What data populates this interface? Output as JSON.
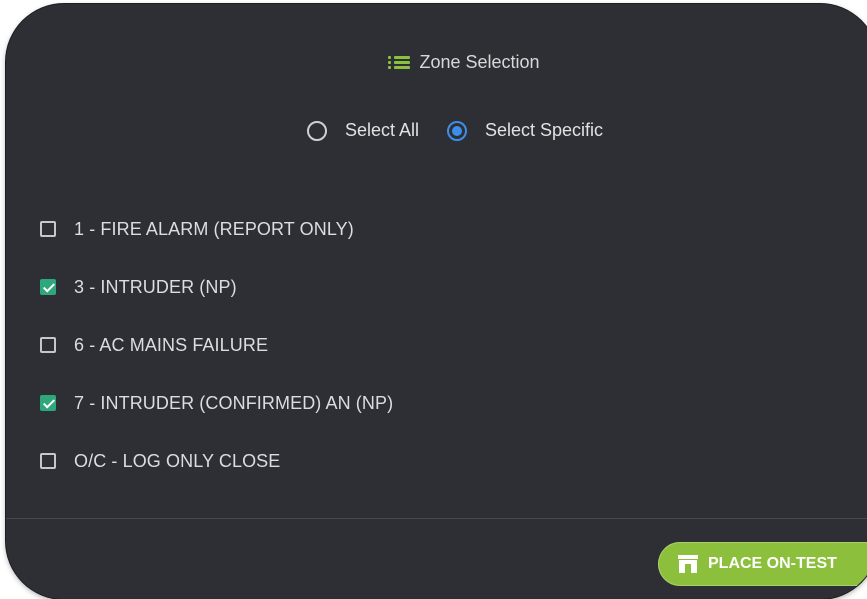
{
  "header": {
    "icon": "list-icon",
    "title": "Zone Selection"
  },
  "selection_mode": {
    "options": [
      {
        "label": "Select All",
        "selected": false
      },
      {
        "label": "Select Specific",
        "selected": true
      }
    ]
  },
  "zones": [
    {
      "label": "1 - FIRE ALARM (REPORT ONLY)",
      "checked": false
    },
    {
      "label": "3 - INTRUDER (NP)",
      "checked": true
    },
    {
      "label": "6 - AC MAINS FAILURE",
      "checked": false
    },
    {
      "label": "7 - INTRUDER (CONFIRMED) AN (NP)",
      "checked": true
    },
    {
      "label": "O/C - LOG ONLY CLOSE",
      "checked": false
    }
  ],
  "footer": {
    "action_label": "PLACE ON-TEST",
    "action_icon": "store-icon"
  },
  "colors": {
    "panel": "#2e2f34",
    "accent_green": "#8bbf3c",
    "radio_selected": "#3d8ee8",
    "checkbox_checked": "#2fa77c"
  }
}
